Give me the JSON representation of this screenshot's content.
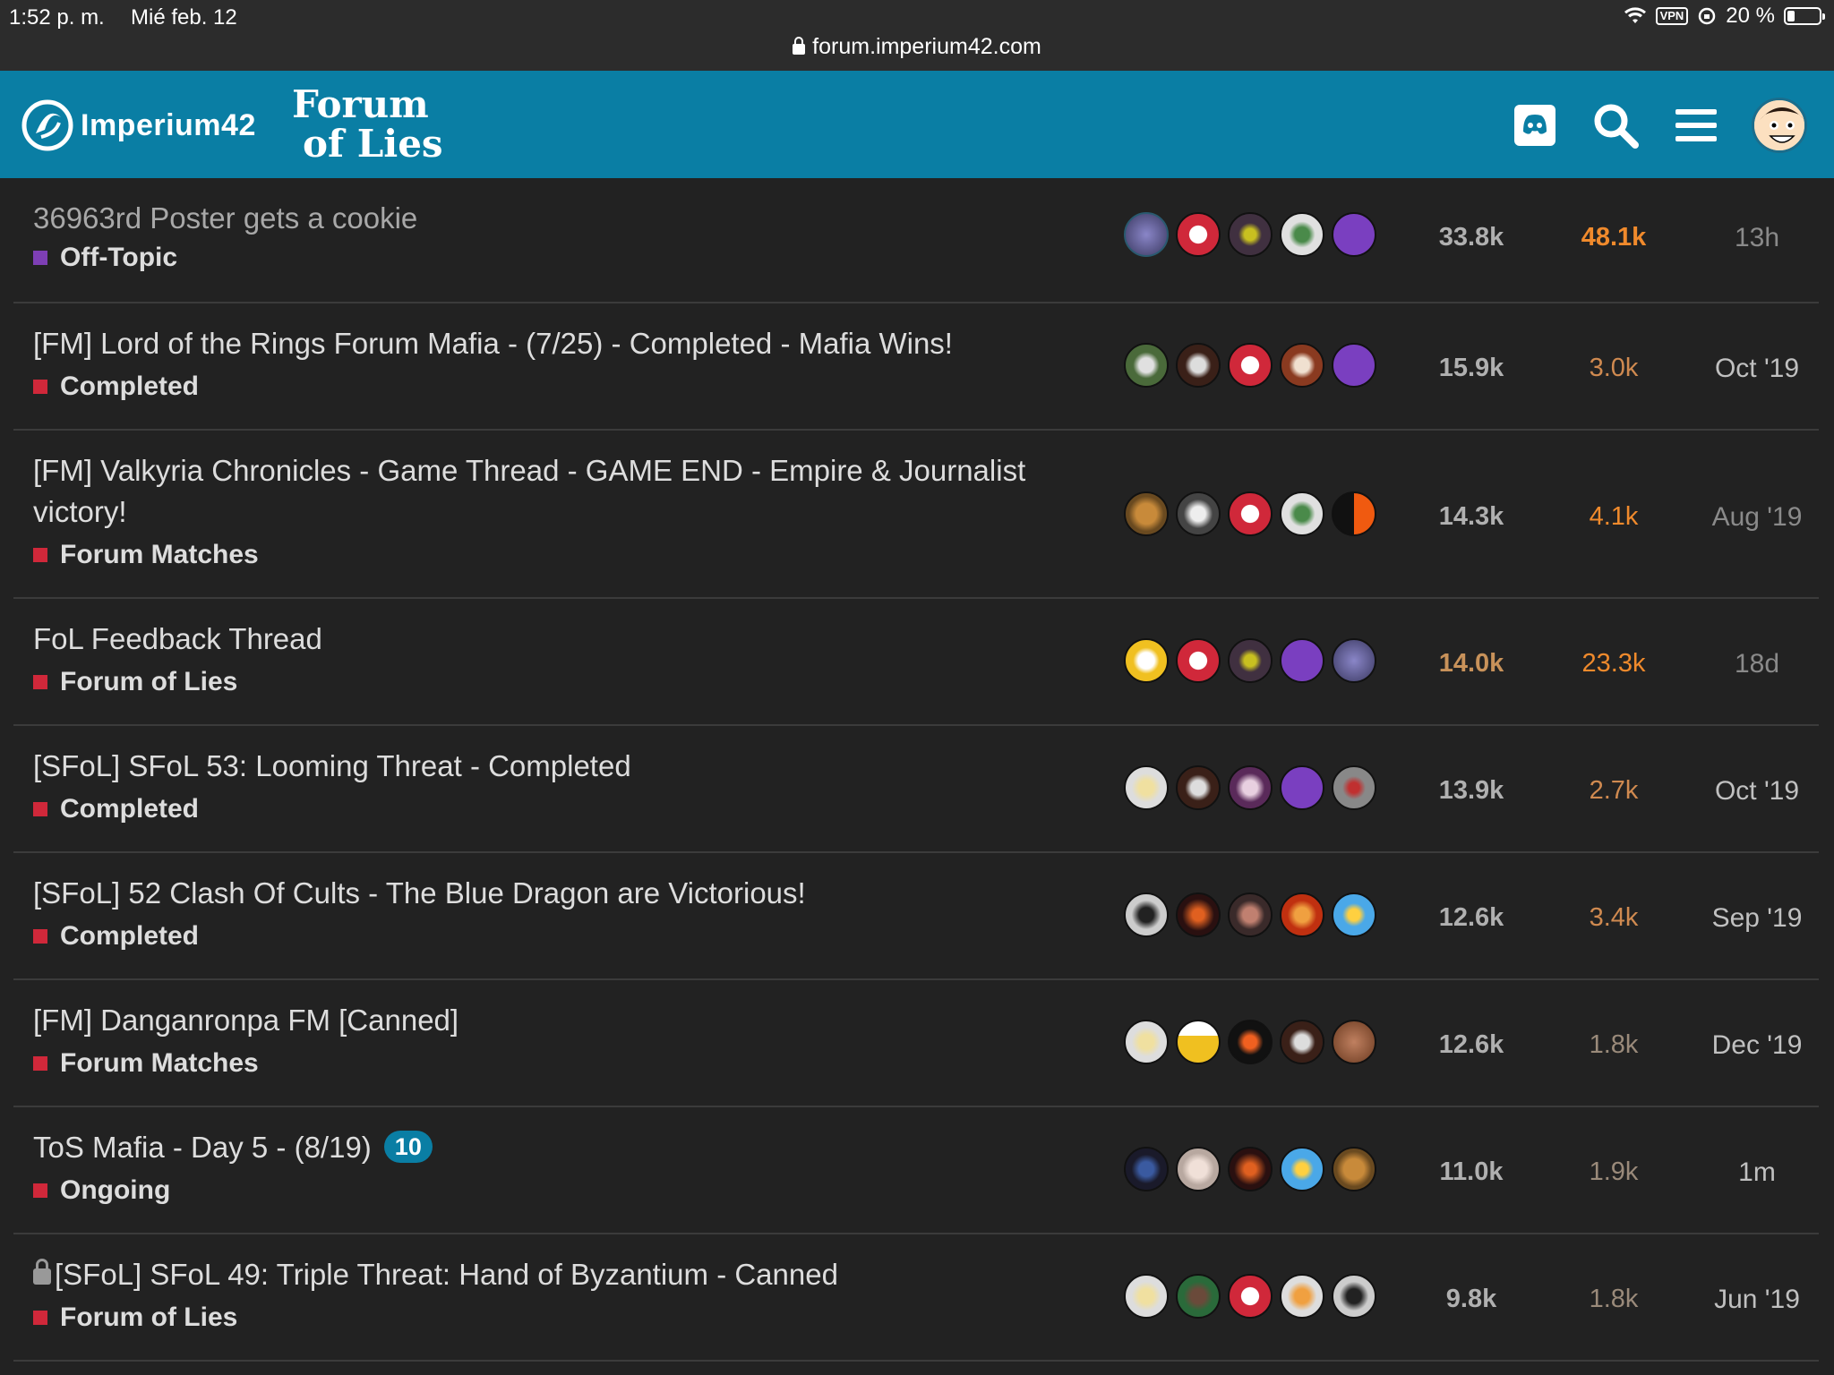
{
  "status_bar": {
    "time": "1:52 p. m.",
    "date": "Mié feb. 12",
    "url": "forum.imperium42.com",
    "vpn": "VPN",
    "battery": "20 %"
  },
  "header": {
    "brand": "Imperium42",
    "logo_line1": "Forum",
    "logo_line2": "of Lies"
  },
  "colors": {
    "header_bg": "#0a7ea4",
    "page_bg": "#222222",
    "off_topic": "#7e3fb5",
    "completed": "#d0283a",
    "reply_hot": "#f08a2c",
    "reply_warm": "#d08a50",
    "reply_cool": "#9a8a7a"
  },
  "topics": [
    {
      "title": "36963rd Poster gets a cookie",
      "category": "Off-Topic",
      "views": "33.8k",
      "replies": "48.1k",
      "activity": "13h"
    },
    {
      "title": "[FM] Lord of the Rings Forum Mafia - (7/25) - Completed - Mafia Wins!",
      "category": "Completed",
      "views": "15.9k",
      "replies": "3.0k",
      "activity": "Oct '19"
    },
    {
      "title": "[FM] Valkyria Chronicles - Game Thread - GAME END - Empire & Journalist victory!",
      "category": "Forum Matches",
      "views": "14.3k",
      "replies": "4.1k",
      "activity": "Aug '19"
    },
    {
      "title": "FoL Feedback Thread",
      "category": "Forum of Lies",
      "views": "14.0k",
      "replies": "23.3k",
      "activity": "18d"
    },
    {
      "title": "[SFoL] SFoL 53: Looming Threat - Completed",
      "category": "Completed",
      "views": "13.9k",
      "replies": "2.7k",
      "activity": "Oct '19"
    },
    {
      "title": "[SFoL] 52 Clash Of Cults - The Blue Dragon are Victorious!",
      "category": "Completed",
      "views": "12.6k",
      "replies": "3.4k",
      "activity": "Sep '19"
    },
    {
      "title": "[FM] Danganronpa FM [Canned]",
      "category": "Forum Matches",
      "views": "12.6k",
      "replies": "1.8k",
      "activity": "Dec '19"
    },
    {
      "title": "ToS Mafia - Day 5 - (8/19)",
      "unread": "10",
      "category": "Ongoing",
      "views": "11.0k",
      "replies": "1.9k",
      "activity": "1m"
    },
    {
      "title": "[SFoL] SFoL 49: Triple Threat: Hand of Byzantium - Canned",
      "category": "Forum of Lies",
      "views": "9.8k",
      "replies": "1.8k",
      "activity": "Jun '19"
    }
  ]
}
